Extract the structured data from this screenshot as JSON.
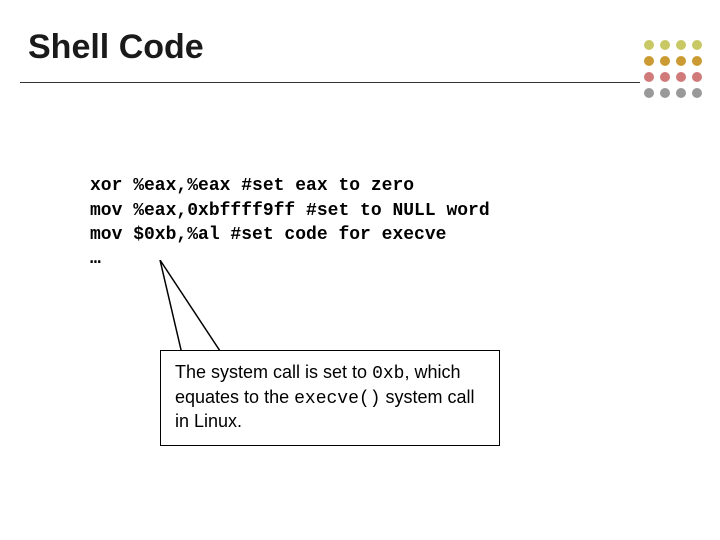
{
  "title": "Shell Code",
  "code": {
    "l1": "xor %eax,%eax #set eax to zero",
    "l2": "mov %eax,0xbffff9ff #set to NULL word",
    "l3": "mov $0xb,%al #set code for execve",
    "l4": "…"
  },
  "callout": {
    "t1": "The system call is set to ",
    "c1": "0xb",
    "t2": ", which equates to the ",
    "c2": "execve()",
    "t3": " system call in Linux."
  },
  "dots": {
    "row1": [
      "#c8c864",
      "#c8c864",
      "#c8c864",
      "#c8c864"
    ],
    "row2": [
      "#cc9a33",
      "#cc9a33",
      "#cc9a33",
      "#cc9a33"
    ],
    "row3": [
      "#d07a7a",
      "#d07a7a",
      "#d07a7a",
      "#d07a7a"
    ],
    "row4": [
      "#999999",
      "#999999",
      "#999999",
      "#999999"
    ]
  }
}
